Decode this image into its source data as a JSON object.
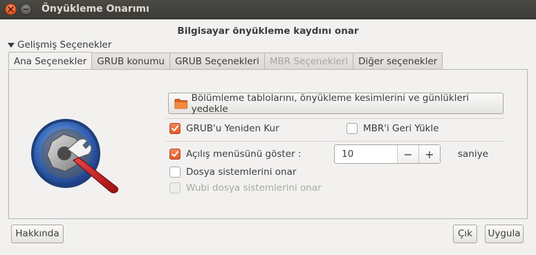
{
  "window": {
    "title": "Önyükleme Onarımı"
  },
  "heading": "Bilgisayar önyükleme kaydını onar",
  "expander": {
    "label": "Gelişmiş Seçenekler"
  },
  "tabs": [
    {
      "label": "Ana Seçenekler",
      "active": true,
      "disabled": false
    },
    {
      "label": "GRUB konumu",
      "active": false,
      "disabled": false
    },
    {
      "label": "GRUB Seçenekleri",
      "active": false,
      "disabled": false
    },
    {
      "label": "MBR Seçenekleri",
      "active": false,
      "disabled": true
    },
    {
      "label": "Diğer seçenekler",
      "active": false,
      "disabled": false
    }
  ],
  "main": {
    "backup_button": {
      "label": "Bölümleme tablolarını, önyükleme kesimlerini ve günlükleri yedekle",
      "icon": "folder-icon"
    },
    "checks": {
      "reinstall_grub": {
        "label": "GRUB'u Yeniden Kur",
        "checked": true
      },
      "restore_mbr": {
        "label": "MBR'i Geri Yükle",
        "checked": false
      },
      "show_menu": {
        "label": "Açılış menüsünü göster :",
        "checked": true
      },
      "repair_fs": {
        "label": "Dosya sistemlerini onar",
        "checked": false
      },
      "repair_wubi": {
        "label": "Wubi dosya sistemlerini onar",
        "checked": false,
        "disabled": true
      }
    },
    "timeout": {
      "value": "10",
      "minus": "−",
      "plus": "+",
      "unit": "saniye"
    }
  },
  "footer": {
    "about_label": "Hakkında",
    "quit_label": "Çık",
    "apply_label": "Uygula"
  },
  "colors": {
    "accent": "#e05a2a",
    "titlebar": "#3c3b37"
  }
}
